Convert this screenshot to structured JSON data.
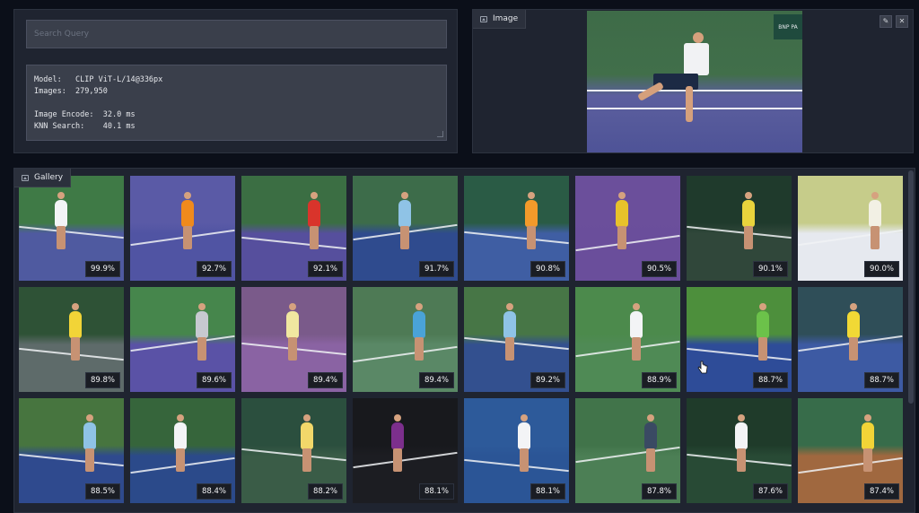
{
  "search": {
    "placeholder": "Search Query",
    "value": ""
  },
  "info": {
    "model_line": "Model:   CLIP ViT-L/14@336px",
    "images_line": "Images:  279,950",
    "encode_line": "Image Encode:  32.0 ms",
    "knn_line": "KNN Search:    40.1 ms"
  },
  "image_panel": {
    "label": "Image",
    "edit_icon": "pencil-icon",
    "close_icon": "close-icon",
    "banner_text": "BNP PA"
  },
  "gallery": {
    "label": "Gallery",
    "items": [
      {
        "score": "99.9%",
        "bg": "#3f7a46",
        "court": "#4f5aa0",
        "shirt": "#f3f4f6"
      },
      {
        "score": "92.7%",
        "bg": "#5a5aa6",
        "court": "#5054a3",
        "shirt": "#f08a1c"
      },
      {
        "score": "92.1%",
        "bg": "#3b6e43",
        "court": "#564f9d",
        "shirt": "#d9342b"
      },
      {
        "score": "91.7%",
        "bg": "#3d6c4a",
        "court": "#2f4b8e",
        "shirt": "#8fc3e6"
      },
      {
        "score": "90.8%",
        "bg": "#2a5b45",
        "court": "#3f5ea3",
        "shirt": "#f39a2a"
      },
      {
        "score": "90.5%",
        "bg": "#6b4f9b",
        "court": "#6a4e9b",
        "shirt": "#e7c22b"
      },
      {
        "score": "90.1%",
        "bg": "#1f3a2c",
        "court": "#30473a",
        "shirt": "#e9d43c"
      },
      {
        "score": "90.0%",
        "bg": "#c6cc8a",
        "court": "#e6e9ef",
        "shirt": "#f2f0e4"
      },
      {
        "score": "89.8%",
        "bg": "#2e5236",
        "court": "#5e6b6a",
        "shirt": "#f2d437"
      },
      {
        "score": "89.6%",
        "bg": "#46864c",
        "court": "#5a52a6",
        "shirt": "#c7c9d0"
      },
      {
        "score": "89.4%",
        "bg": "#7a5a8a",
        "court": "#8a63a3",
        "shirt": "#f0e7a0"
      },
      {
        "score": "89.4%",
        "bg": "#4e7a55",
        "court": "#5a8866",
        "shirt": "#4aa3d8"
      },
      {
        "score": "89.2%",
        "bg": "#477646",
        "court": "#33508f",
        "shirt": "#8fc3e6"
      },
      {
        "score": "88.9%",
        "bg": "#4c8a4c",
        "court": "#4f8a55",
        "shirt": "#f3f4f6"
      },
      {
        "score": "88.7%",
        "bg": "#4d8f3c",
        "court": "#2e4c98",
        "shirt": "#6cc24a"
      },
      {
        "score": "88.7%",
        "bg": "#2f4e58",
        "court": "#3d5aa3",
        "shirt": "#f1d935"
      },
      {
        "score": "88.5%",
        "bg": "#47753f",
        "court": "#2f4a8e",
        "shirt": "#8fc3e6"
      },
      {
        "score": "88.4%",
        "bg": "#36653b",
        "court": "#2b4a8a",
        "shirt": "#f3f4f6"
      },
      {
        "score": "88.2%",
        "bg": "#2b4f3e",
        "court": "#3a5c47",
        "shirt": "#f2d86a"
      },
      {
        "score": "88.1%",
        "bg": "#18191d",
        "court": "#1c1d22",
        "shirt": "#7c2f8c"
      },
      {
        "score": "88.1%",
        "bg": "#2d5a9a",
        "court": "#2b5596",
        "shirt": "#f3f4f6"
      },
      {
        "score": "87.8%",
        "bg": "#41744a",
        "court": "#4c7f55",
        "shirt": "#3a4a63"
      },
      {
        "score": "87.6%",
        "bg": "#1f3b2a",
        "court": "#284a35",
        "shirt": "#f3f4f6"
      },
      {
        "score": "87.4%",
        "bg": "#376c4a",
        "court": "#a0683f",
        "shirt": "#f2d437"
      }
    ]
  }
}
